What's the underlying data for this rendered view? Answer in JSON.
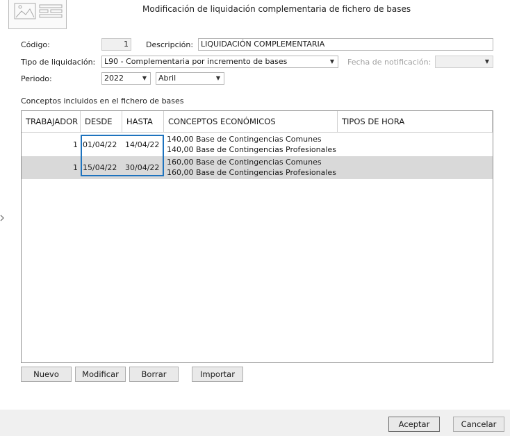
{
  "window": {
    "title": "Modificación de liquidación complementaria de fichero de bases"
  },
  "form": {
    "codigo_label": "Código:",
    "codigo_value": "1",
    "descripcion_label": "Descripción:",
    "descripcion_value": "LIQUIDACIÓN COMPLEMENTARIA",
    "tipo_label": "Tipo de liquidación:",
    "tipo_value": "L90 - Complementaria por incremento de bases",
    "fecha_label": "Fecha de notificación:",
    "fecha_value": "",
    "periodo_label": "Periodo:",
    "periodo_year": "2022",
    "periodo_month": "Abril"
  },
  "grid": {
    "section_label": "Conceptos incluidos en el fichero de bases",
    "columns": [
      "TRABAJADOR",
      "DESDE",
      "HASTA",
      "CONCEPTOS ECONÓMICOS",
      "TIPOS DE HORA"
    ],
    "rows": [
      {
        "trabajador": "1",
        "desde": "01/04/22",
        "hasta": "14/04/22",
        "conceptos": [
          {
            "importe": "140,00",
            "concepto": "Base de Contingencias Comunes"
          },
          {
            "importe": "140,00",
            "concepto": "Base de Contingencias Profesionales"
          }
        ],
        "tipos_hora": ""
      },
      {
        "trabajador": "1",
        "desde": "15/04/22",
        "hasta": "30/04/22",
        "conceptos": [
          {
            "importe": "160,00",
            "concepto": "Base de Contingencias Comunes"
          },
          {
            "importe": "160,00",
            "concepto": "Base de Contingencias Profesionales"
          }
        ],
        "tipos_hora": ""
      }
    ]
  },
  "actions": {
    "nuevo": "Nuevo",
    "modificar": "Modificar",
    "borrar": "Borrar",
    "importar": "Importar"
  },
  "footer": {
    "aceptar": "Aceptar",
    "cancelar": "Cancelar"
  },
  "icons": {
    "combo_arrow": "chevron-down-icon",
    "logo": "form-placeholder-icon",
    "side_marker": "chevron-right-icon"
  },
  "colors": {
    "selection_border": "#1e73be",
    "alt_row": "#d9d9d9",
    "footer_bg": "#f0f0f0"
  }
}
